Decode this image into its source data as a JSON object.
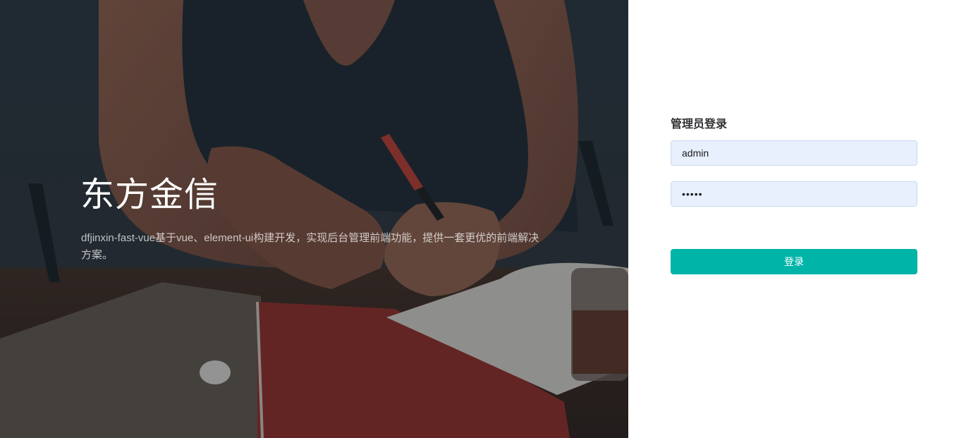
{
  "hero": {
    "title": "东方金信",
    "description": "dfjinxin-fast-vue基于vue、element-ui构建开发，实现后台管理前端功能，提供一套更优的前端解决方案。"
  },
  "login": {
    "title": "管理员登录",
    "username_value": "admin",
    "password_value": "admin",
    "submit_label": "登录"
  },
  "colors": {
    "accent": "#00b4a8",
    "input_bg": "#e8f0fe",
    "hero_dark": "#1f2a30"
  },
  "icons": {
    "background": "desk-writing-photo"
  }
}
